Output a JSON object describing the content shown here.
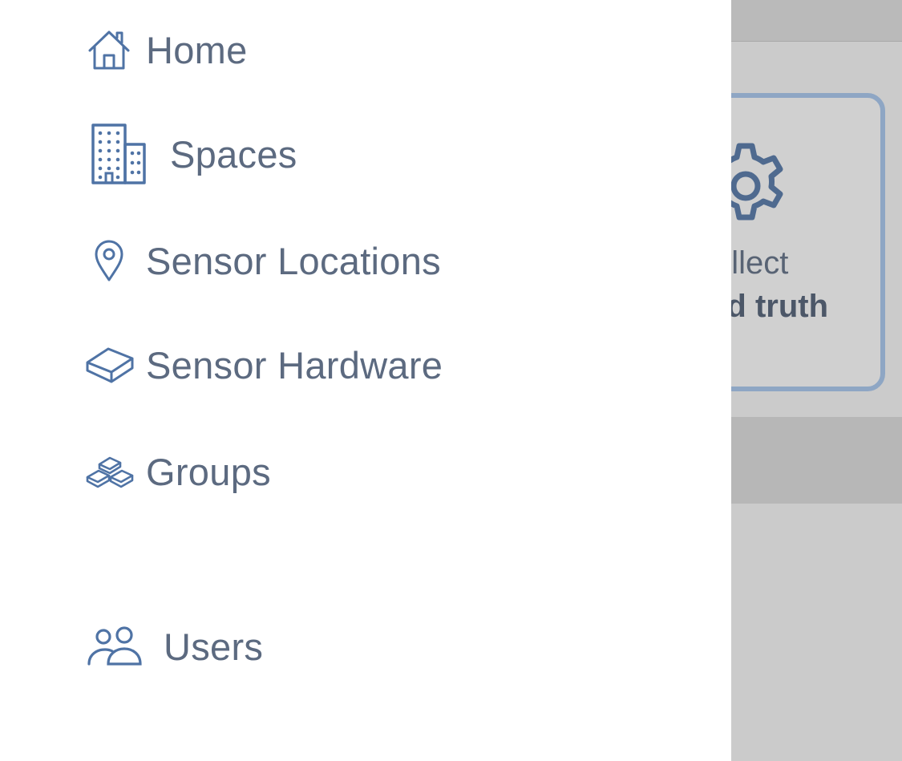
{
  "nav": {
    "items": [
      {
        "label": "Home",
        "icon": "home-icon"
      },
      {
        "label": "Spaces",
        "icon": "building-icon"
      },
      {
        "label": "Sensor Locations",
        "icon": "location-pin-icon"
      },
      {
        "label": "Sensor Hardware",
        "icon": "sensor-device-icon"
      },
      {
        "label": "Groups",
        "icon": "groups-icon"
      },
      {
        "label": "Users",
        "icon": "users-icon"
      }
    ]
  },
  "background_card": {
    "line1": "ollect",
    "line2": "nd truth",
    "icon": "gear-icon"
  },
  "colors": {
    "nav_text": "#5c6a80",
    "icon_stroke": "#4f73a5",
    "card_border": "#8ea6c4",
    "overlay_gray": "#cbcbcb"
  }
}
